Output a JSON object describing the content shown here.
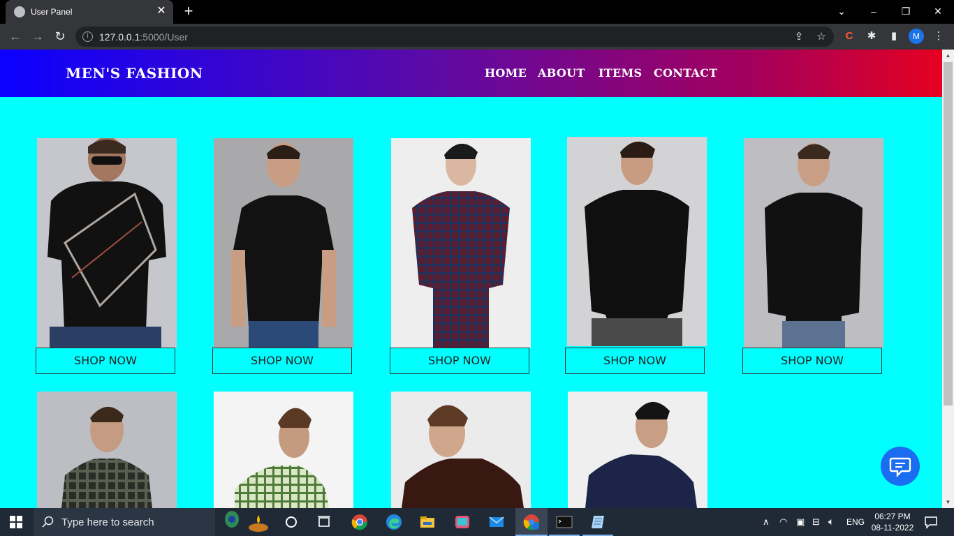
{
  "browser": {
    "tab_title": "User Panel",
    "url_host": "127.0.0.1",
    "url_path": ":5000/User",
    "profile_initial": "M"
  },
  "site": {
    "brand": "MEN'S FASHION",
    "nav": [
      "HOME",
      "ABOUT",
      "ITEMS",
      "CONTACT"
    ],
    "shop_label": "SHOP NOW"
  },
  "taskbar": {
    "search_placeholder": "Type here to search",
    "language": "ENG",
    "time": "06:27 PM",
    "date": "08-11-2022"
  },
  "colors": {
    "page_bg": "#00ffff",
    "nav_gradient_start": "#0b00ff",
    "nav_gradient_end": "#e60021",
    "chat_button": "#1a6cf0"
  }
}
